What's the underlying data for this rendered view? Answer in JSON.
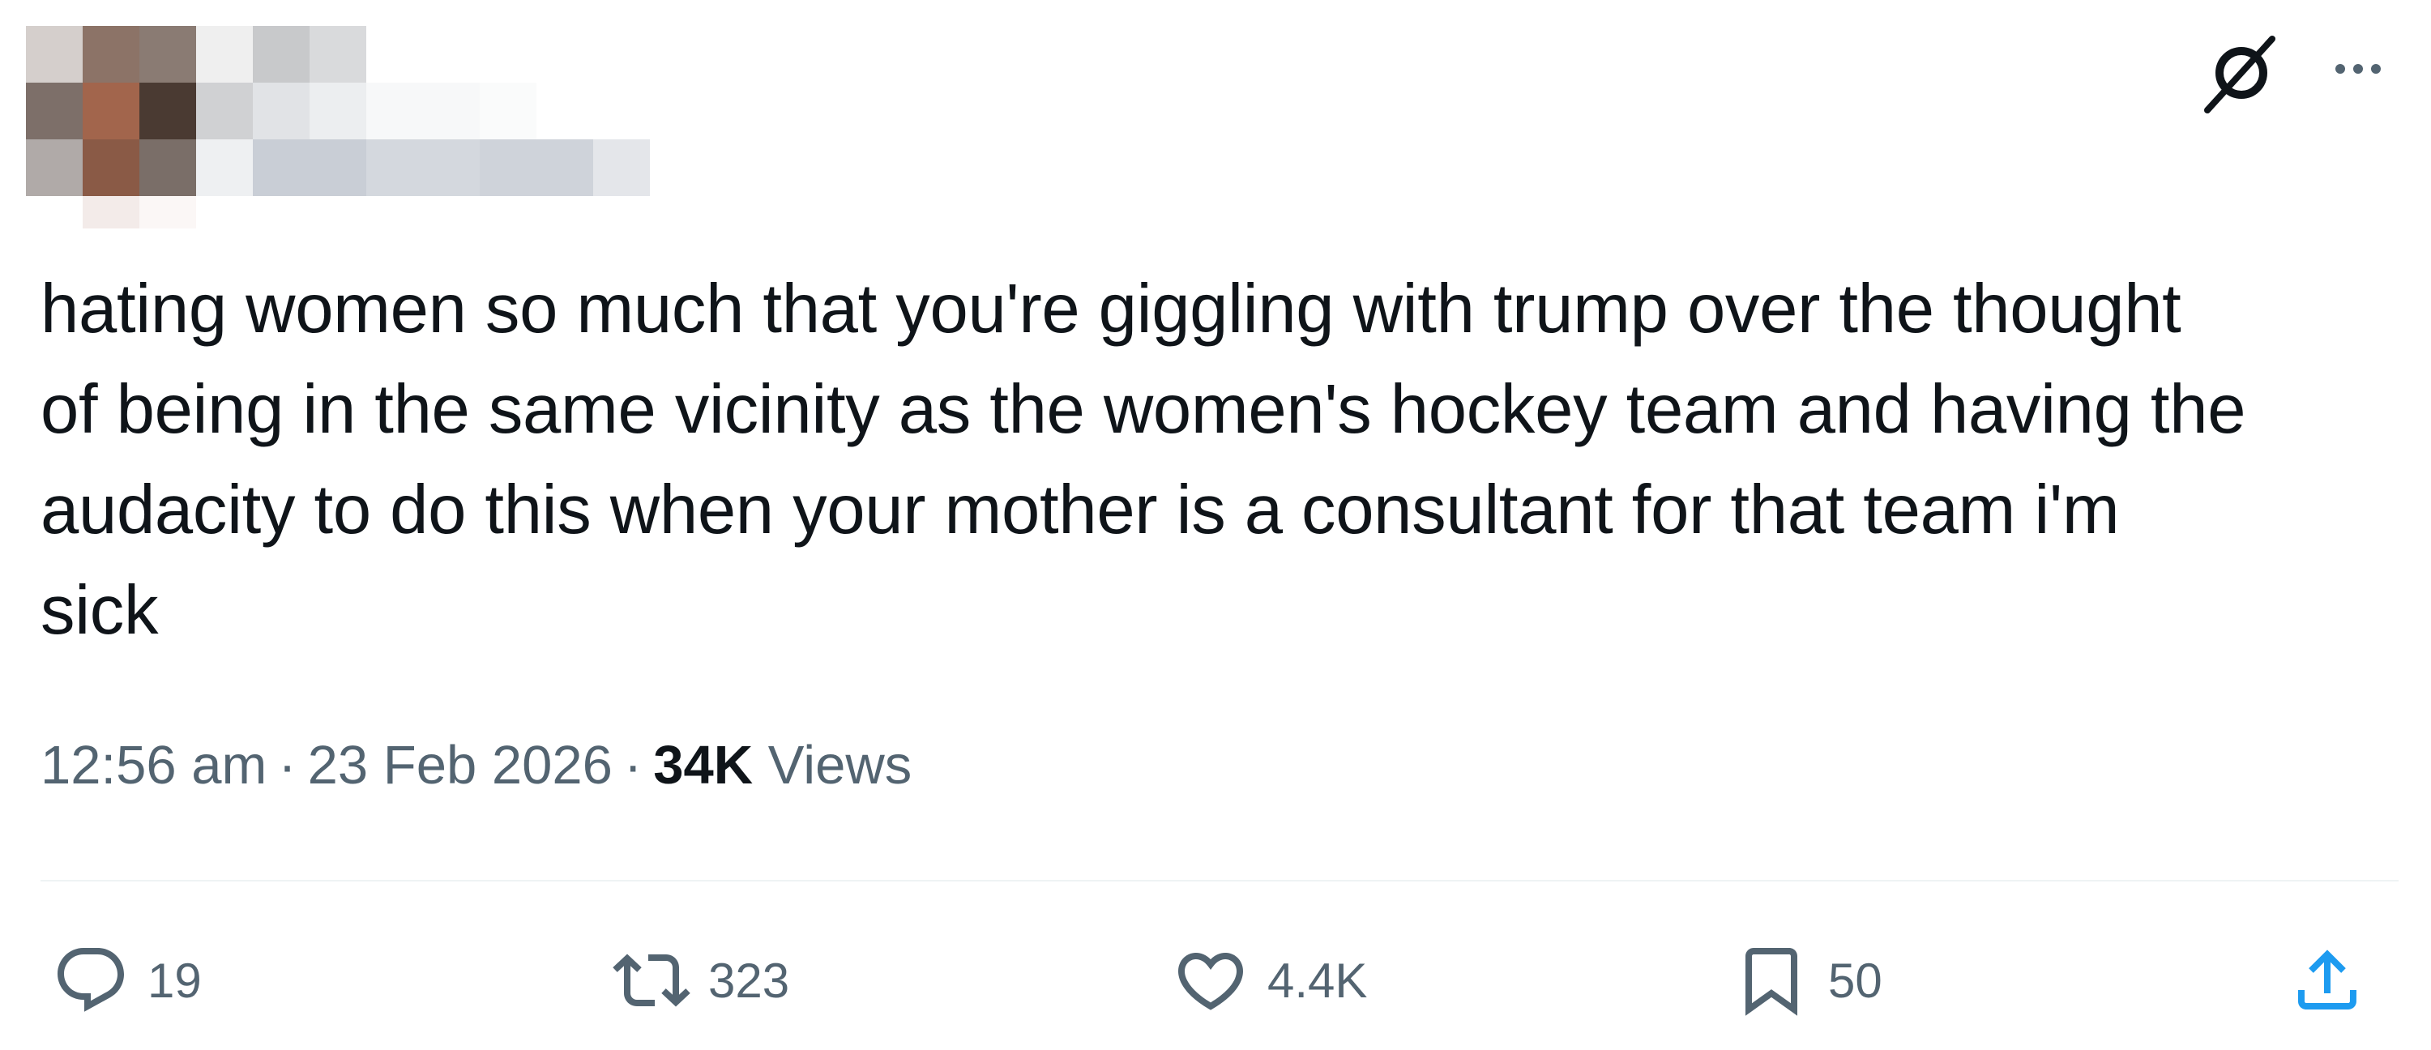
{
  "author": {
    "avatar": "avatar (pixelated)",
    "display_name": "",
    "handle": ""
  },
  "header": {
    "grok_icon": "grok-icon",
    "more_icon": "more-icon"
  },
  "tweet": {
    "text": "hating women so much that you're giggling with trump over the thought\nof being in the same vicinity as the women's hockey team and having the\naudacity to do this when your mother is a consultant for that team i'm\nsick"
  },
  "meta": {
    "time": "12:56 am",
    "separator": "·",
    "date": "23 Feb 2026",
    "views_count": "34K",
    "views_label": "Views"
  },
  "actions": {
    "reply_count": "19",
    "repost_count": "323",
    "like_count": "4.4K",
    "bookmark_count": "50",
    "icons": [
      "reply-icon",
      "repost-icon",
      "like-icon",
      "bookmark-icon",
      "share-icon"
    ]
  },
  "colors": {
    "text": "#0f1419",
    "secondary": "#536471",
    "divider": "#eff3f4"
  }
}
